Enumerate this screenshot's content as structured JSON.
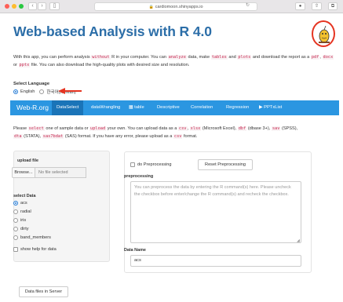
{
  "browser": {
    "url": "cardiomoon.shinyapps.io"
  },
  "app": {
    "title": "Web-based Analysis with R 4.0"
  },
  "intro": {
    "p1": "With this app, you can perform analysis ",
    "c1": "without",
    "p2": " R in your computer. You can ",
    "c2": "analyze",
    "p3": " data, make ",
    "c3": "tables",
    "p4": " and ",
    "c4": "plots",
    "p5": " and download the report as a ",
    "c5": "pdf",
    "p6": ", ",
    "c6": "docx",
    "p7": " or ",
    "c7": "pptx",
    "p8": " file. You can also download the high-quality plots with desired size and resolution."
  },
  "language": {
    "label": "Select Language",
    "options": [
      "English",
      "한국어(Korean)"
    ],
    "selected": "English"
  },
  "navbar": {
    "brand": "Web-R.org",
    "tabs": [
      "DataSelect",
      "dataWrangling",
      "table",
      "Descriptive",
      "Correlation",
      "Regression",
      "PPTxList"
    ],
    "active": "DataSelect"
  },
  "desc": {
    "p1": "Please ",
    "c1": "select",
    "p2": " one of sample data or ",
    "c2": "upload",
    "p3": " your own. You can upload data as a ",
    "c3": "csv",
    "p4": ", ",
    "c4": "xlsx",
    "p5": " (Microsoft Excel), ",
    "c5": "dbf",
    "p6": " (dbase 3+), ",
    "c6": "sav",
    "p7": " (SPSS),",
    "c7": "dta",
    "p8": " (STATA), ",
    "c8": "sas7bdat",
    "p9": " (SAS) format. If you have any error, please upload as a ",
    "c9": "csv",
    "p10": " format."
  },
  "left_panel": {
    "upload_label": "upload file",
    "browse_label": "Browse...",
    "no_file": "No file selected",
    "select_label": "select Data",
    "datasets": [
      "acs",
      "radial",
      "iris",
      "dirty",
      "band_members"
    ],
    "selected_dataset": "acs",
    "help_label": "show help for data"
  },
  "right_panel": {
    "preprocess_check": "do Preprocessing",
    "reset_label": "Reset Preprocessing",
    "preprocess_label": "preprocessing",
    "textarea_placeholder": "You can preprocess the data by entering the R command(s) here. Please uncheck the checkbox before enter/change the R command(s) and recheck the checkbox.",
    "data_name_label": "Data Name",
    "data_name_value": "acs"
  },
  "footer": {
    "server_button": "Data files in Server"
  },
  "colors": {
    "accent": "#2b96e1",
    "active_tab": "#1a74b8",
    "title": "#2c6ea8",
    "annotation": "#e53421"
  }
}
